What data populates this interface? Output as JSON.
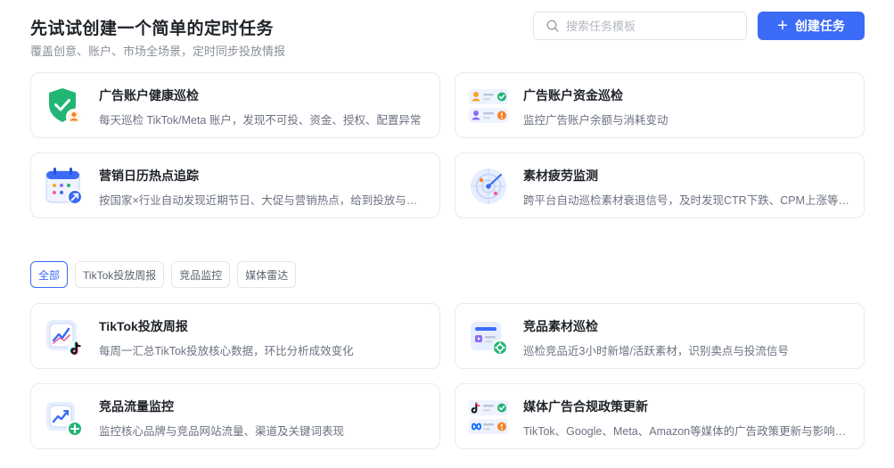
{
  "header": {
    "title": "先试试创建一个简单的定时任务",
    "subtitle": "覆盖创意、账户、市场全场景，定时同步投放情报",
    "search_placeholder": "搜索任务模板",
    "create_label": "创建任务",
    "create_icon": "plus-icon"
  },
  "featured": [
    {
      "title": "广告账户健康巡检",
      "desc": "每天巡检 TikTok/Meta 账户，发现不可投、资金、授权、配置异常",
      "icon": "shield-check-icon"
    },
    {
      "title": "广告账户资金巡检",
      "desc": "监控广告账户余额与消耗变动",
      "icon": "account-balance-icon"
    },
    {
      "title": "营销日历热点追踪",
      "desc": "按国家×行业自动发现近期节日、大促与营销热点，给到投放与素材建议",
      "icon": "calendar-icon"
    },
    {
      "title": "素材疲劳监测",
      "desc": "跨平台自动巡检素材衰退信号，及时发现CTR下跌、CPM上涨等疲劳问题",
      "icon": "radar-icon"
    }
  ],
  "filters": [
    {
      "label": "全部",
      "active": true
    },
    {
      "label": "TikTok投放周报",
      "active": false
    },
    {
      "label": "竞品监控",
      "active": false
    },
    {
      "label": "媒体雷达",
      "active": false
    }
  ],
  "templates": [
    {
      "title": "TikTok投放周报",
      "desc": "每周一汇总TikTok投放核心数据，环比分析成效变化",
      "icon": "tiktok-chart-icon"
    },
    {
      "title": "竞品素材巡检",
      "desc": "巡检竞品近3小时新增/活跃素材，识别卖点与投流信号",
      "icon": "creative-scan-icon"
    },
    {
      "title": "竞品流量监控",
      "desc": "监控核心品牌与竞品网站流量、渠道及关键词表现",
      "icon": "traffic-chart-icon"
    },
    {
      "title": "媒体广告合规政策更新",
      "desc": "TikTok、Google、Meta、Amazon等媒体的广告政策更新与影响解读",
      "icon": "media-policy-icon"
    }
  ],
  "colors": {
    "accent": "#3b6bf7",
    "success": "#22b573",
    "warning": "#f5832a"
  }
}
